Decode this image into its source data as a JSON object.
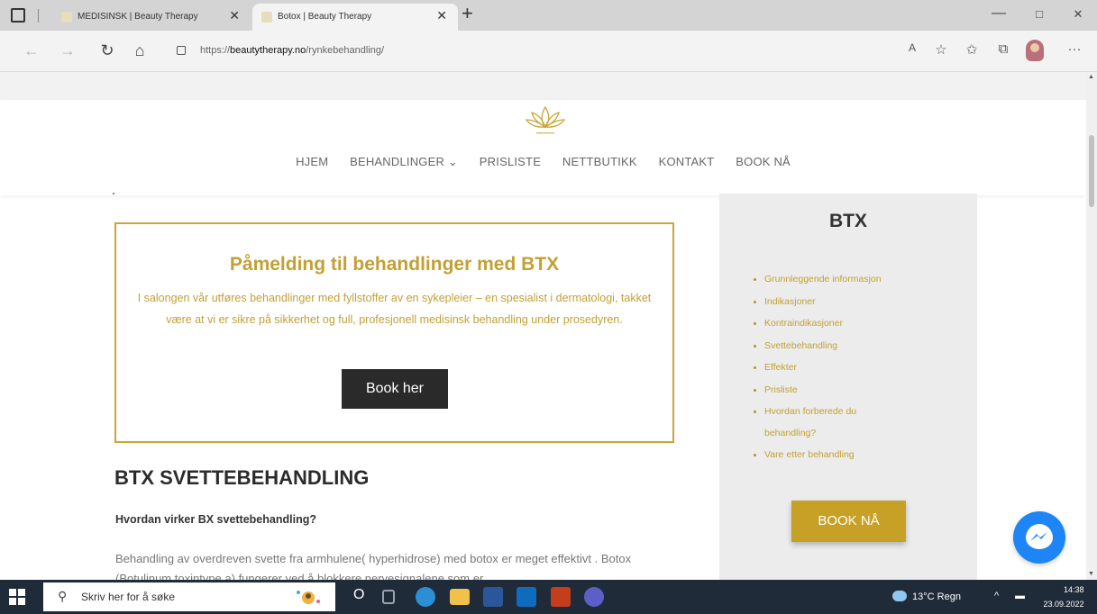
{
  "browser": {
    "tabs": [
      {
        "title": "MEDISINSK | Beauty Therapy",
        "active": false
      },
      {
        "title": "Botox | Beauty Therapy",
        "active": true
      }
    ],
    "new_tab_symbol": "+",
    "window_controls": [
      "—",
      "□",
      "✕"
    ],
    "url_prefix": "https://",
    "url_domain": "beautytherapy.no",
    "url_path": "/rynkebehandling/",
    "nav_icons": [
      "back-icon",
      "forward-icon",
      "refresh-icon",
      "home-icon"
    ],
    "toolbar_icons": [
      "read-aloud-icon",
      "add-favorite-icon",
      "favorites-icon",
      "collections-icon",
      "profile-avatar",
      "more-icon"
    ],
    "more_label": "···"
  },
  "site": {
    "nav": [
      "HJEM",
      "BEHANDLINGER ⌄",
      "PRISLISTE",
      "NETTBUTIKK",
      "KONTAKT",
      "BOOK NÅ"
    ],
    "accent_color": "#c3a033"
  },
  "promo": {
    "title": "Påmelding til behandlinger med BTX",
    "body": "I salongen vår utføres behandlinger med fyllstoffer av en sykepleier – en spesialist i dermatologi, takket være at vi er sikre på sikkerhet og full, profesjonell medisinsk behandling under prosedyren.",
    "button": "Book her"
  },
  "article": {
    "heading": "BTX SVETTEBEHANDLING",
    "subheading": "Hvordan virker BX svettebehandling?",
    "paragraph": "Behandling av overdreven svette fra armhulene( hyperhidrose) med botox er meget effektivt . Botox (Botulinum toxintype a) fungerer ved å blokkere nervesignalene som er"
  },
  "sidebar": {
    "title": "BTX",
    "links": [
      "Grunnleggende informasjon",
      "Indikasjoner",
      "Kontraindikasjoner",
      "Svettebehandling",
      "Effekter",
      "Prisliste",
      "Hvordan forberede du behandling?",
      "Vare etter behandling"
    ],
    "button": "BOOK NÅ"
  },
  "taskbar": {
    "search_placeholder": "Skriv her for å søke",
    "task_view_symbol": "O",
    "weather": "13°C  Regn",
    "tray_symbols": [
      "^",
      "▬"
    ],
    "time": "14:38",
    "date": "23.09.2022"
  }
}
